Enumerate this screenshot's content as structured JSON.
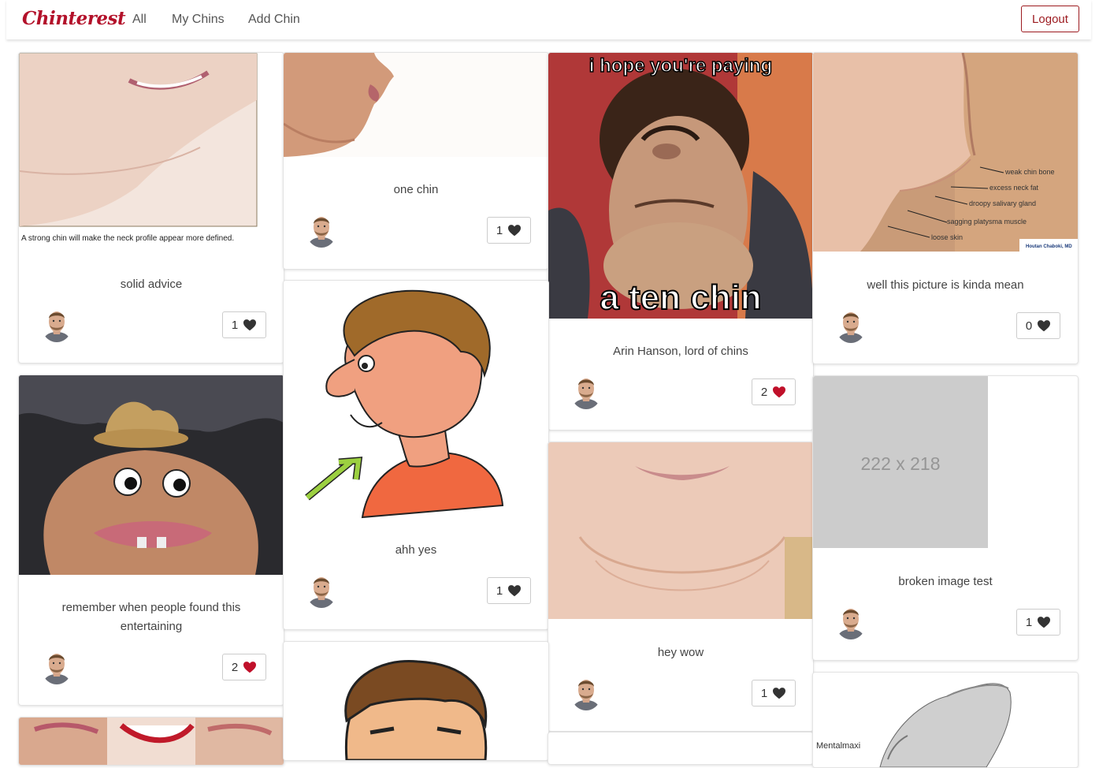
{
  "brand": "Chinterest",
  "nav": {
    "all": "All",
    "my_chins": "My Chins",
    "add_chin": "Add Chin",
    "logout": "Logout"
  },
  "colors": {
    "brand": "#b3112a",
    "liked_heart": "#c0102a",
    "heart": "#333333"
  },
  "pins": [
    {
      "title": "solid advice",
      "likes": "1",
      "liked": false,
      "caption": "A strong chin will make the neck profile appear more defined."
    },
    {
      "title": "one chin",
      "likes": "1",
      "liked": false
    },
    {
      "title": "Arin Hanson, lord of chins",
      "likes": "2",
      "liked": true,
      "meme_top": "i hope you're paying",
      "meme_bottom": "a ten chin"
    },
    {
      "title": "well this picture is kinda mean",
      "likes": "0",
      "liked": false,
      "annotations": [
        "weak chin bone",
        "excess neck fat",
        "droopy salivary gland",
        "sagging platysma muscle",
        "loose skin"
      ],
      "credit": "Houtan Chaboki, MD"
    },
    {
      "title": "remember when people found this entertaining",
      "likes": "2",
      "liked": true
    },
    {
      "title": "ahh yes",
      "likes": "1",
      "liked": false
    },
    {
      "title": "hey wow",
      "likes": "1",
      "liked": false
    },
    {
      "title": "broken image test",
      "likes": "1",
      "liked": false,
      "placeholder": "222 x 218"
    },
    {
      "partial_text": "Mentalmaxi"
    }
  ]
}
